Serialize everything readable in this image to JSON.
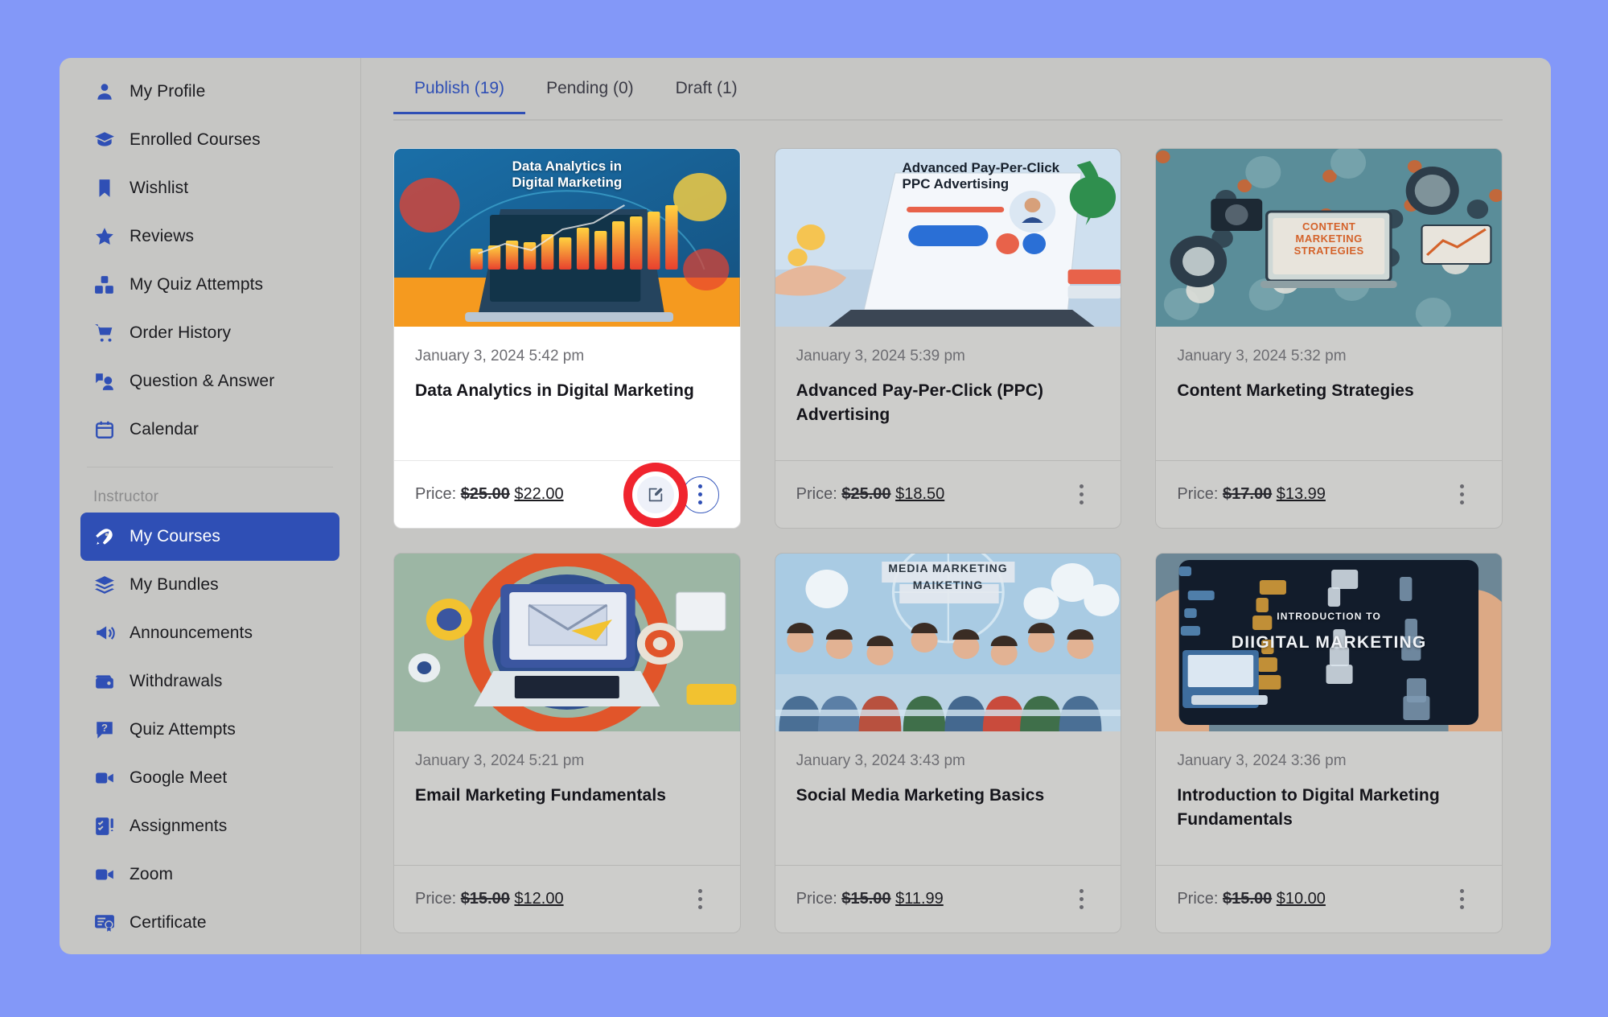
{
  "theme": {
    "page_background": "#8398f8",
    "panel_background": "#c6c6c4",
    "accent": "#2f4fb5",
    "highlight_ring": "#f0242e",
    "card_background": "#cdcdcb",
    "featured_card_background": "#ffffff"
  },
  "sidebar": {
    "items": [
      {
        "label": "My Profile",
        "icon": "user-icon",
        "active": false
      },
      {
        "label": "Enrolled Courses",
        "icon": "graduation-cap-icon",
        "active": false
      },
      {
        "label": "Wishlist",
        "icon": "bookmark-icon",
        "active": false
      },
      {
        "label": "Reviews",
        "icon": "star-icon",
        "active": false
      },
      {
        "label": "My Quiz Attempts",
        "icon": "quiz-blocks-icon",
        "active": false
      },
      {
        "label": "Order History",
        "icon": "shopping-cart-icon",
        "active": false
      },
      {
        "label": "Question & Answer",
        "icon": "question-answer-icon",
        "active": false
      },
      {
        "label": "Calendar",
        "icon": "calendar-icon",
        "active": false
      }
    ],
    "section_label": "Instructor",
    "instructor_items": [
      {
        "label": "My Courses",
        "icon": "rocket-icon",
        "active": true
      },
      {
        "label": "My Bundles",
        "icon": "layers-icon",
        "active": false
      },
      {
        "label": "Announcements",
        "icon": "megaphone-icon",
        "active": false
      },
      {
        "label": "Withdrawals",
        "icon": "wallet-icon",
        "active": false
      },
      {
        "label": "Quiz Attempts",
        "icon": "quiz-question-icon",
        "active": false
      },
      {
        "label": "Google Meet",
        "icon": "video-camera-icon",
        "active": false
      },
      {
        "label": "Assignments",
        "icon": "checklist-icon",
        "active": false
      },
      {
        "label": "Zoom",
        "icon": "video-camera-icon",
        "active": false
      },
      {
        "label": "Certificate",
        "icon": "certificate-icon",
        "active": false
      }
    ]
  },
  "tabs": [
    {
      "label": "Publish (19)",
      "active": true
    },
    {
      "label": "Pending (0)",
      "active": false
    },
    {
      "label": "Draft (1)",
      "active": false
    }
  ],
  "price_label": "Price:",
  "cards": [
    {
      "date": "January 3, 2024 5:42 pm",
      "title": "Data Analytics in Digital Marketing",
      "price_old": "$25.00",
      "price_new": "$22.00",
      "featured": true,
      "has_edit_button": true,
      "highlighted": true,
      "thumb": {
        "overlay_text": "Data Analytics in\nDigital Marketing",
        "palette": [
          "#1a6fa8",
          "#f59a1f",
          "#e8412e",
          "#ffd23f",
          "#14405f"
        ],
        "style": "analytics-laptop"
      }
    },
    {
      "date": "January 3, 2024 5:39 pm",
      "title": "Advanced Pay-Per-Click (PPC) Advertising",
      "price_old": "$25.00",
      "price_new": "$18.50",
      "featured": false,
      "has_edit_button": false,
      "highlighted": false,
      "thumb": {
        "overlay_text": "Advanced Pay-Per-Click\nPPC Advertising",
        "palette": [
          "#cfe0ef",
          "#2a6fd6",
          "#e8624a",
          "#f5c451",
          "#2f8f4e"
        ],
        "style": "ppc-laptop"
      }
    },
    {
      "date": "January 3, 2024 5:32 pm",
      "title": "Content Marketing Strategies",
      "price_old": "$17.00",
      "price_new": "$13.99",
      "featured": false,
      "has_edit_button": false,
      "highlighted": false,
      "thumb": {
        "overlay_text": "CONTENT\nMARKETING\nSTRATEGIES",
        "palette": [
          "#5a8d99",
          "#d4622a",
          "#2d3d4a",
          "#e8e4dc",
          "#7aa6ae"
        ],
        "style": "content-icons"
      }
    },
    {
      "date": "January 3, 2024 5:21 pm",
      "title": "Email Marketing Fundamentals",
      "price_old": "$15.00",
      "price_new": "$12.00",
      "featured": false,
      "has_edit_button": false,
      "highlighted": false,
      "thumb": {
        "overlay_text": "",
        "palette": [
          "#9cb6a4",
          "#e1552a",
          "#2f4f8f",
          "#f2c230",
          "#dfe6ea"
        ],
        "style": "email-laptop"
      }
    },
    {
      "date": "January 3, 2024 3:43 pm",
      "title": "Social Media Marketing Basics",
      "price_old": "$15.00",
      "price_new": "$11.99",
      "featured": false,
      "has_edit_button": false,
      "highlighted": false,
      "thumb": {
        "overlay_text": "MEDIA MARKETING\nMAIKETING",
        "palette": [
          "#a9cbe3",
          "#3f6f4a",
          "#c94b3c",
          "#e4e9ee",
          "#4a6f95"
        ],
        "style": "people-group"
      }
    },
    {
      "date": "January 3, 2024 3:36 pm",
      "title": "Introduction to Digital Marketing Fundamentals",
      "price_old": "$15.00",
      "price_new": "$10.00",
      "featured": false,
      "has_edit_button": false,
      "highlighted": false,
      "thumb": {
        "overlay_text": "INTRODUCTION TO\nDIIGITAL MARKETING",
        "palette": [
          "#121c2b",
          "#5a8fc0",
          "#e0a33a",
          "#dde6ef",
          "#7f9ab3"
        ],
        "style": "tablet-dark"
      }
    }
  ]
}
